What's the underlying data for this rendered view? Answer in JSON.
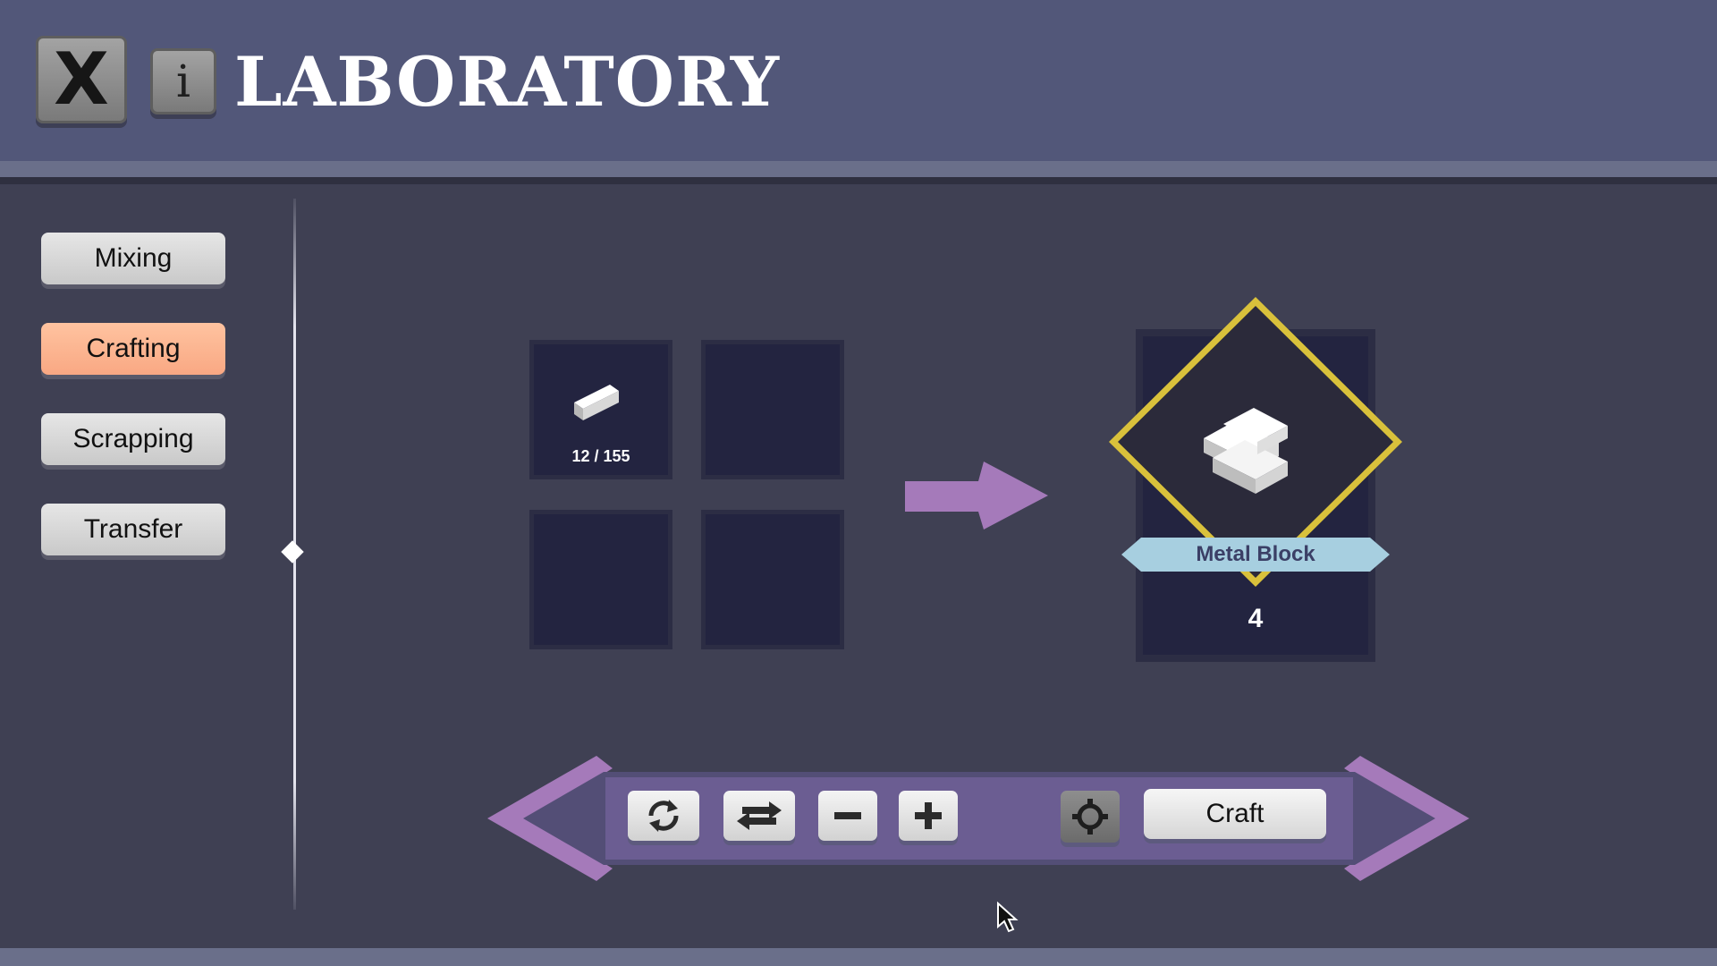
{
  "header": {
    "title": "LABORATORY",
    "close_glyph": "X",
    "info_glyph": "i"
  },
  "sidebar": {
    "items": [
      {
        "label": "Mixing",
        "active": false
      },
      {
        "label": "Crafting",
        "active": true
      },
      {
        "label": "Scrapping",
        "active": false
      },
      {
        "label": "Transfer",
        "active": false
      }
    ]
  },
  "crafting": {
    "slots": [
      {
        "item": "metal-bar",
        "quantity": "12 / 155"
      },
      {
        "item": null,
        "quantity": ""
      },
      {
        "item": null,
        "quantity": ""
      },
      {
        "item": null,
        "quantity": ""
      }
    ],
    "result": {
      "name": "Metal Block",
      "count": "4",
      "icon": "metal-block-icon"
    }
  },
  "toolbar": {
    "buttons": [
      "refresh-icon",
      "swap-icon",
      "minus-icon",
      "plus-icon",
      "target-icon"
    ],
    "craft_label": "Craft"
  },
  "colors": {
    "header_bg": "#525779",
    "body_bg": "#3f4053",
    "active_tab": "#f9b08c",
    "slot_bg": "#232440",
    "accent_purple": "#a57aba",
    "result_frame": "#e7cf3f",
    "banner": "#a7cfe0"
  }
}
